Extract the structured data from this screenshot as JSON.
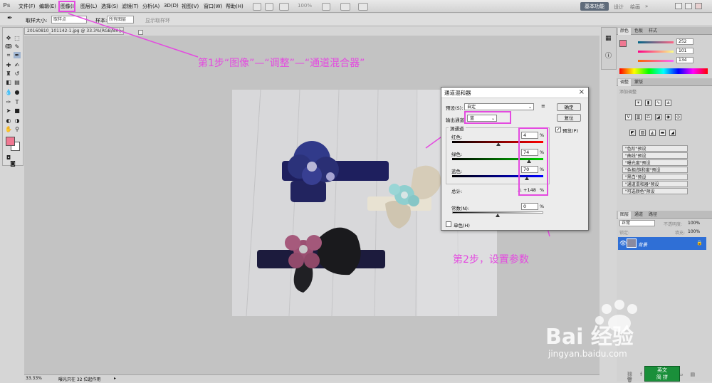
{
  "menu": {
    "logo": "Ps",
    "items": [
      "文件(F)",
      "编辑(E)",
      "图像(I)",
      "图层(L)",
      "选择(S)",
      "滤镜(T)",
      "分析(A)",
      "3D(D)",
      "视图(V)",
      "窗口(W)",
      "帮助(H)"
    ],
    "zoom": "100%",
    "workspace_label": "基本功能",
    "design_label": "设计",
    "paint_label": "绘画"
  },
  "options_bar": {
    "sample_size_label": "取样大小:",
    "sample_size_value": "取样点",
    "sample_label": "样本:",
    "sample_value": "所有图层",
    "show_ring_label": "显示取样环"
  },
  "document": {
    "tab_title": "20160810_101142-1.jpg @ 33.3%(RGB/8#)",
    "status_zoom": "33.33%",
    "status_info": "曝光只在 32 位起作用"
  },
  "annotations": {
    "step1": "第1步“图像”—“调整”—“通道混合器”",
    "step2": "第2步，设置参数"
  },
  "dialog": {
    "title": "通道混和器",
    "preset_label": "预设(S):",
    "preset_value": "自定",
    "output_channel_label": "输出通道:",
    "output_channel_value": "蓝",
    "source_channels_label": "源通道",
    "ok_label": "确定",
    "reset_label": "复位",
    "preview_label": "预览(P)",
    "red_label": "红色:",
    "red_value": "4",
    "green_label": "绿色:",
    "green_value": "74",
    "blue_label": "蓝色:",
    "blue_value": "70",
    "percent": "%",
    "total_label": "总计:",
    "total_value": "+148",
    "constant_label": "常数(N):",
    "constant_value": "0",
    "mono_label": "单色(H)"
  },
  "panels": {
    "color_tabs": [
      "颜色",
      "色板",
      "样式"
    ],
    "color_values": [
      "252",
      "101",
      "134"
    ],
    "adjust_tabs": [
      "调整",
      "蒙版"
    ],
    "adjust_hint": "添加调整",
    "presets": [
      "\"色阶\"预设",
      "\"曲线\"预设",
      "\"曝光度\"预设",
      "\"色相/饱和度\"预设",
      "\"黑白\"预设",
      "\"通道混和器\"预设",
      "\"可选颜色\"预设"
    ],
    "layers_tabs": [
      "图层",
      "通道",
      "路径"
    ],
    "blend_mode": "正常",
    "opacity_label": "不透明度:",
    "opacity_value": "100%",
    "lock_label": "锁定:",
    "fill_label": "填充:",
    "fill_value": "100%",
    "layer_name": "背景"
  },
  "watermark": {
    "brand": "Bai 经验",
    "url": "jingyan.baidu.com"
  },
  "ime": {
    "line1": "英文",
    "line2": "简 拼"
  }
}
